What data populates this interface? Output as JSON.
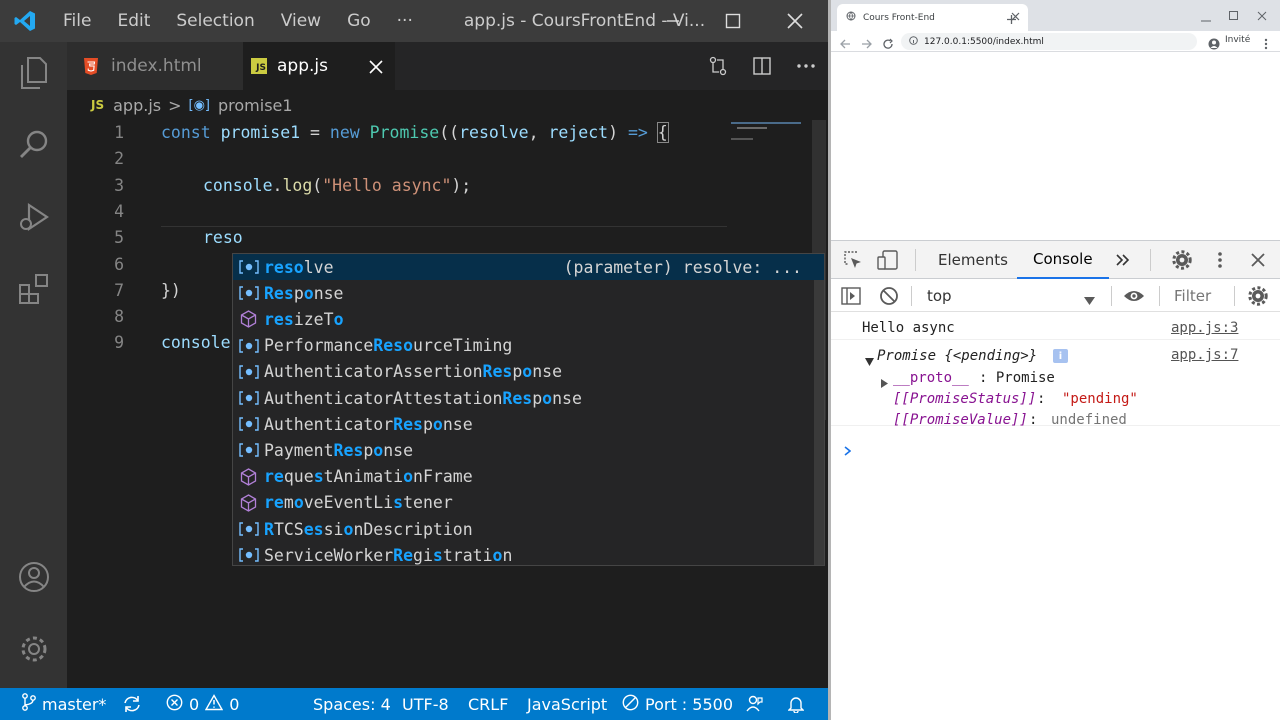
{
  "colors": {
    "vscode_titlebar": "#3c3c3c",
    "vscode_editor_bg": "#1e1e1e",
    "statusbar": "#007acc",
    "suggest_highlight": "#18a3ff",
    "selected_suggestion": "#062f4a"
  },
  "vscode": {
    "title": "app.js - CoursFrontEnd - Vi...",
    "menu": [
      "File",
      "Edit",
      "Selection",
      "View",
      "Go",
      "···"
    ],
    "tabs": [
      {
        "label": "index.html",
        "icon": "html5-icon",
        "active": false
      },
      {
        "label": "app.js",
        "icon": "js-icon",
        "active": true
      }
    ],
    "breadcrumb": {
      "file": "app.js",
      "separator": ">",
      "symbol": "promise1",
      "file_icon": "JS"
    },
    "code": {
      "line_numbers": [
        "1",
        "2",
        "3",
        "4",
        "5",
        "6",
        "7",
        "8",
        "9"
      ],
      "l1": {
        "kw": "const",
        "name": "promise1",
        "eq": " = ",
        "new": "new",
        "cls": "Promise",
        "open": "((",
        "p1": "resolve",
        "comma": ", ",
        "p2": "reject",
        "close": ") ",
        "arrow": "=>",
        "brace": "{"
      },
      "l3": {
        "obj": "console",
        "dot": ".",
        "fn": "log",
        "open": "(",
        "str": "\"Hello async\"",
        "close": ");"
      },
      "l5": "reso",
      "l7": "})",
      "l9": "console"
    },
    "suggestions": [
      {
        "icon": "variable-icon",
        "before": "",
        "hl": "reso",
        "after": "lve",
        "detail": "(parameter) resolve: ..."
      },
      {
        "icon": "variable-icon",
        "before": "",
        "hl": "Res",
        "mid": "p",
        "hl2": "o",
        "after": "nse"
      },
      {
        "icon": "method-icon",
        "before": "",
        "hl": "res",
        "mid": "izeT",
        "hl2": "o",
        "after": ""
      },
      {
        "icon": "variable-icon",
        "before": "Performance",
        "hl": "Reso",
        "after": "urceTiming"
      },
      {
        "icon": "variable-icon",
        "before": "AuthenticatorAssertion",
        "hl": "Res",
        "mid": "p",
        "hl2": "o",
        "after": "nse"
      },
      {
        "icon": "variable-icon",
        "before": "AuthenticatorAttestation",
        "hl": "Res",
        "mid": "p",
        "hl2": "o",
        "after": "nse"
      },
      {
        "icon": "variable-icon",
        "before": "Authenticator",
        "hl": "Res",
        "mid": "p",
        "hl2": "o",
        "after": "nse"
      },
      {
        "icon": "variable-icon",
        "before": "Payment",
        "hl": "Res",
        "mid": "p",
        "hl2": "o",
        "after": "nse"
      },
      {
        "icon": "method-icon",
        "before": "",
        "hl": "re",
        "mid": "que",
        "hl2": "s",
        "after": "tAnimati",
        "hl3": "o",
        "after2": "nFrame"
      },
      {
        "icon": "method-icon",
        "before": "",
        "hl": "re",
        "mid": "m",
        "hl2": "o",
        "after": "veEventLi",
        "hl3": "s",
        "after2": "tener"
      },
      {
        "icon": "variable-icon",
        "before": "",
        "hl": "R",
        "mid": "TCS",
        "hl2": "es",
        "after": "si",
        "hl3": "o",
        "after2": "nDescription"
      },
      {
        "icon": "variable-icon",
        "before": "ServiceWorker",
        "hl": "Re",
        "mid": "gi",
        "hl2": "s",
        "after": "trati",
        "hl3": "o",
        "after2": "n"
      }
    ],
    "status": {
      "branch": "master*",
      "errors": "0",
      "warnings": "0",
      "spaces": "Spaces: 4",
      "encoding": "UTF-8",
      "eol": "CRLF",
      "language": "JavaScript",
      "port": "Port : 5500"
    }
  },
  "chrome": {
    "tab_title": "Cours Front-End",
    "url": "127.0.0.1:5500/index.html",
    "profile": "Invité",
    "devtools": {
      "tabs": [
        "Elements",
        "Console"
      ],
      "active_tab": "Console",
      "context": "top",
      "filter_placeholder": "Filter",
      "logs": [
        {
          "text": "Hello async",
          "source": "app.js:3"
        },
        {
          "text": "Promise {<pending>}",
          "source": "app.js:7"
        }
      ],
      "proto_key": "__proto__",
      "proto_value": ": Promise",
      "status_key": "[[PromiseStatus]]",
      "status_value": "\"pending\"",
      "value_key": "[[PromiseValue]]",
      "value_value": "undefined",
      "info_badge": "i",
      "colon": ": "
    }
  }
}
